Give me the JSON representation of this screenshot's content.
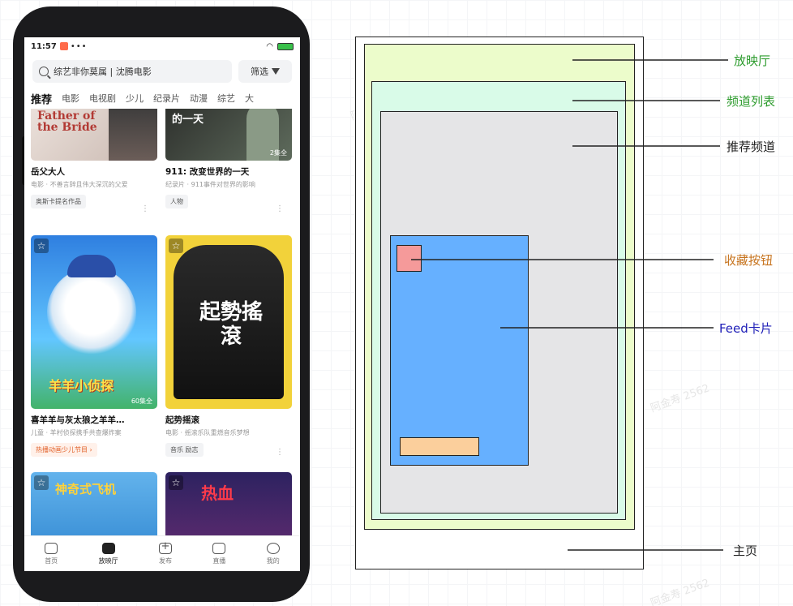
{
  "phone": {
    "statusbar": {
      "time": "11:57",
      "dots": "•••"
    },
    "search": {
      "placeholder": "综艺非你莫属 | 沈腾电影"
    },
    "filter_label": "筛选",
    "tabs": [
      "推荐",
      "电影",
      "电视剧",
      "少儿",
      "纪录片",
      "动漫",
      "综艺",
      "大"
    ],
    "cards": [
      {
        "poster_text": "Father of the Bride",
        "title": "岳父大人",
        "sub": "电影 · 不善言辞且伟大深沉的父爱",
        "tag": "奥斯卡提名作品",
        "colors": [
          "#e8dcd6",
          "#b23a34"
        ]
      },
      {
        "poster_text": "的一天",
        "badge": "2集全",
        "title": "911: 改变世界的一天",
        "sub": "纪录片 · 911事件对世界的影响",
        "tag": "人物",
        "colors": [
          "#3d3f3a",
          "#6e7a6a"
        ]
      },
      {
        "poster_text": "羊羊小侦探",
        "badge": "60集全",
        "title": "喜羊羊与灰太狼之羊羊…",
        "sub": "儿童 · 羊村侦探携手共查爆炸案",
        "tag": "热播动画少儿节目 ›",
        "colors": [
          "#3a8be8",
          "#7fd0ff"
        ]
      },
      {
        "poster_text": "起勢搖滾",
        "title": "起势摇滚",
        "sub": "电影 · 摇滚乐队重燃音乐梦想",
        "tag": "音乐 励志",
        "colors": [
          "#f2d23a",
          "#1a1a1a"
        ]
      },
      {
        "poster_text": "神奇式飞机",
        "title": "",
        "sub": "",
        "tag": "",
        "colors": [
          "#6fb6e8",
          "#e89a3a"
        ]
      },
      {
        "poster_text": "热血",
        "title": "",
        "sub": "",
        "tag": "",
        "colors": [
          "#3a2a6e",
          "#d8344a"
        ]
      }
    ],
    "tabbar": [
      "首页",
      "放映厅",
      "发布",
      "直播",
      "我的"
    ],
    "more_glyph": "⋮",
    "fav_glyph": "☆"
  },
  "diagram": {
    "labels": {
      "screening_hall": "放映厅",
      "channel_list": "频道列表",
      "recommend_channel": "推荐频道",
      "favorite_button": "收藏按钮",
      "feed_card": "Feed卡片",
      "home": "主页"
    },
    "colors": {
      "screening_hall": "#ecfccb",
      "channel_list": "#d9fbe8",
      "recommend_channel": "#e5e5e7",
      "feed_card": "#66b0ff",
      "favorite_button": "#f59a9a",
      "bottom_bar": "#fbcf9c",
      "label_green": "#2e9c2e",
      "label_orange": "#c7741f",
      "label_blue": "#1f1fb8",
      "label_dark": "#222222"
    }
  },
  "watermark": "阿金寿 2562"
}
